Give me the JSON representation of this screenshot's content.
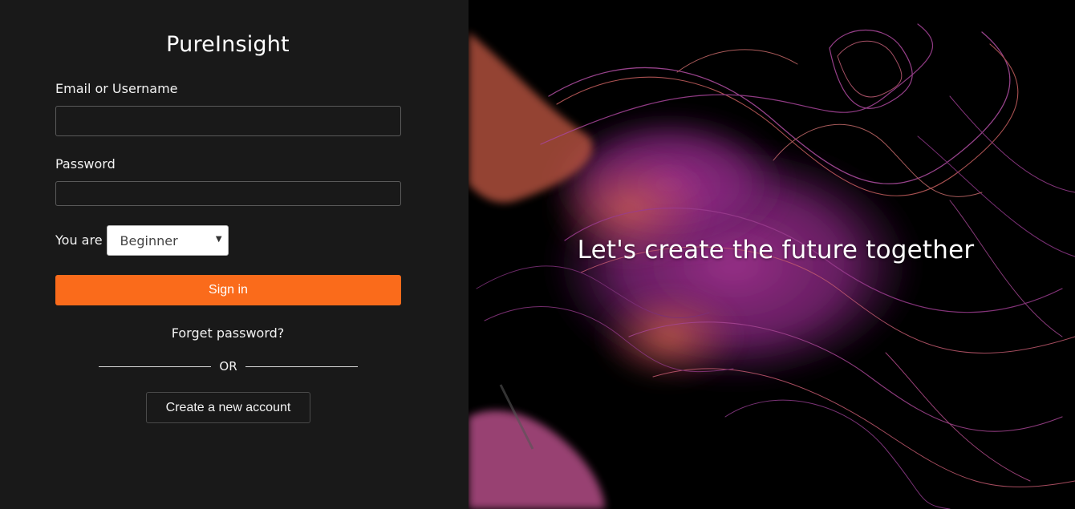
{
  "login": {
    "brand": "PureInsight",
    "email_label": "Email or Username",
    "email_value": "",
    "password_label": "Password",
    "password_value": "",
    "role_label": "You are",
    "role_selected": "Beginner",
    "signin_label": "Sign in",
    "forgot_label": "Forget password?",
    "divider_text": "OR",
    "create_label": "Create a new account"
  },
  "hero": {
    "tagline": "Let's create the future together"
  },
  "colors": {
    "panel_bg": "#191919",
    "accent": "#fa6b1b",
    "art_bg": "#000000",
    "art_magenta": "#9b2f8f",
    "art_orange": "#d8653f"
  },
  "icons": {
    "select_caret": "caret-down-icon"
  }
}
